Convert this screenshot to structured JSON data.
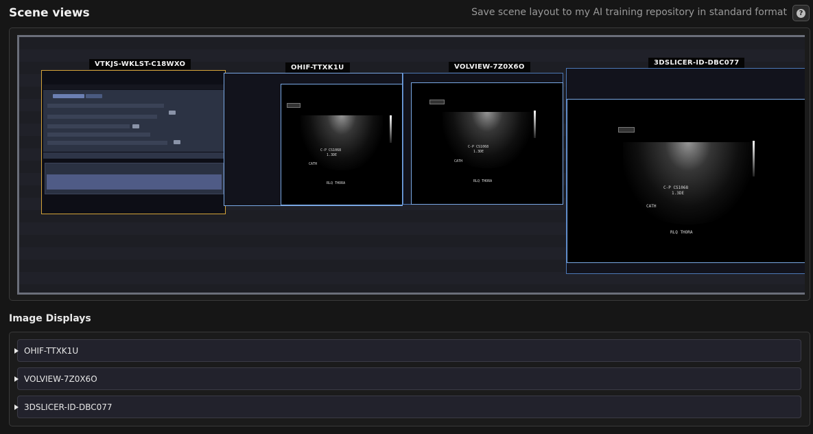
{
  "header": {
    "title": "Scene views",
    "save_label": "Save scene layout to my AI training repository in standard format",
    "help_glyph": "?"
  },
  "scene": {
    "views": [
      {
        "id": "VTKJS-WKLST-C18WXO",
        "highlight": "#d6a53a"
      },
      {
        "id": "OHIF-TTXK1U",
        "highlight": "#7aa9e6"
      },
      {
        "id": "VOLVIEW-7Z0X6O",
        "highlight": "#7aa9e6"
      },
      {
        "id": "3DSLICER-ID-DBC077",
        "highlight": "#7aa9e6"
      }
    ]
  },
  "displays": {
    "title": "Image Displays",
    "items": [
      {
        "label": "OHIF-TTXK1U"
      },
      {
        "label": "VOLVIEW-7Z0X6O"
      },
      {
        "label": "3DSLICER-ID-DBC077"
      }
    ]
  },
  "ultrasound": {
    "text_1": "C-P CS1068",
    "text_2": "1.3DE",
    "text_3": "CATH",
    "text_4": "RLQ THORA"
  }
}
